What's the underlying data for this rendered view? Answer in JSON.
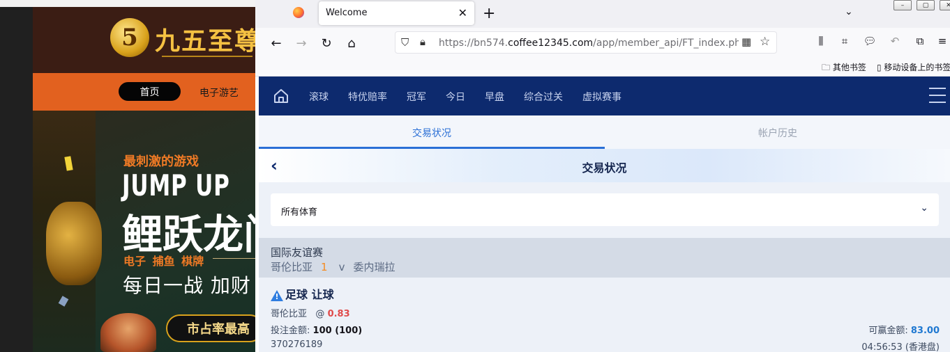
{
  "left_site": {
    "logo_glyph": "5",
    "logo_text": "九五至尊",
    "nav": {
      "home": "首页",
      "games": "电子游艺"
    },
    "banner": {
      "tagline": "最刺激的游戏",
      "headline": "JUMP UP",
      "title": "鲤跃龙门",
      "categories": "电子 捕鱼 棋牌",
      "slogan": "每日一战 加财",
      "pill": "市占率最高"
    }
  },
  "browser": {
    "tab_title": "Welcome",
    "url_prefix": "https://bn574.",
    "url_domain": "coffee12345.com",
    "url_path": "/app/member_api/FT_index.php?",
    "bookmarks": [
      "其他书签",
      "移动设备上的书签"
    ],
    "window_buttons": [
      "–",
      "▢",
      "✕"
    ]
  },
  "page": {
    "nav_items": [
      "滚球",
      "特优赔率",
      "冠军",
      "今日",
      "早盘",
      "综合过关",
      "虚拟赛事"
    ],
    "tabs": {
      "active": "交易状况",
      "inactive": "帐户历史"
    },
    "title": "交易状况",
    "sport_filter": "所有体育",
    "league": "国际友谊赛",
    "match": {
      "home": "哥伦比亚",
      "score": "1",
      "vs": "v",
      "away": "委内瑞拉"
    },
    "bet": {
      "type": "足球 让球",
      "selection": "哥伦比亚",
      "at": "@",
      "odds": "0.83",
      "stake_label": "投注金额:",
      "stake": "100 (100)",
      "win_label": "可赢金额:",
      "win": "83.00",
      "ticket_id": "370276189",
      "time": "04:56:53 (香港盘)"
    }
  },
  "colors": {
    "nav_bg": "#0d2a6e",
    "active_tab": "#2a6fd6",
    "score": "#f58a1f",
    "odds": "#e04a4a",
    "win": "#1f78d1",
    "left_nav": "#e2611f"
  }
}
